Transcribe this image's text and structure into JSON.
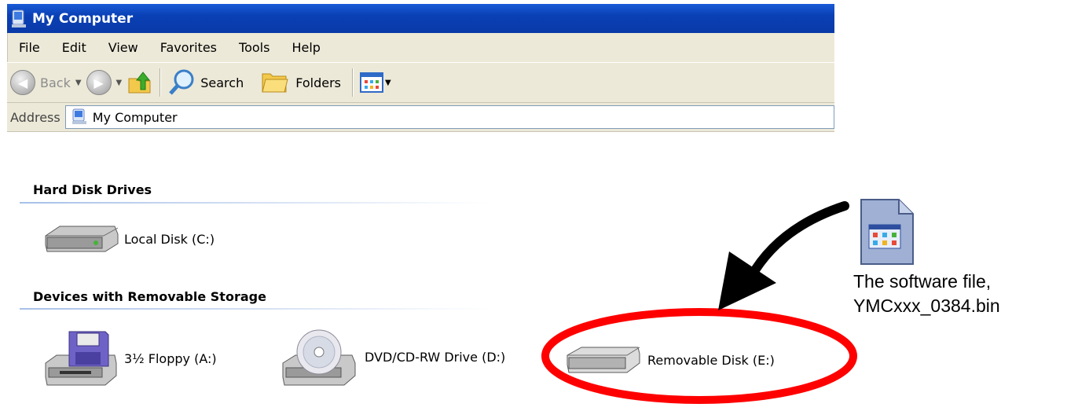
{
  "window": {
    "title": "My Computer"
  },
  "menu": [
    "File",
    "Edit",
    "View",
    "Favorites",
    "Tools",
    "Help"
  ],
  "toolbar": {
    "back": "Back",
    "search": "Search",
    "folders": "Folders"
  },
  "address": {
    "label": "Address",
    "value": "My Computer"
  },
  "groups": {
    "hard_disk": {
      "title": "Hard Disk Drives",
      "items": [
        {
          "label": "Local Disk (C:)"
        }
      ]
    },
    "removable": {
      "title": "Devices with Removable Storage",
      "items": [
        {
          "label": "3½ Floppy (A:)"
        },
        {
          "label": "DVD/CD-RW Drive (D:)"
        },
        {
          "label": "Removable Disk (E:)"
        }
      ]
    }
  },
  "annotation": {
    "line1": "The software file,",
    "line2": "YMCxxx_0384.bin",
    "highlight_color": "#ff0000",
    "arrow_color": "#000000"
  },
  "colors": {
    "titlebar": "#0a3aa8",
    "chrome": "#ece9d8"
  }
}
